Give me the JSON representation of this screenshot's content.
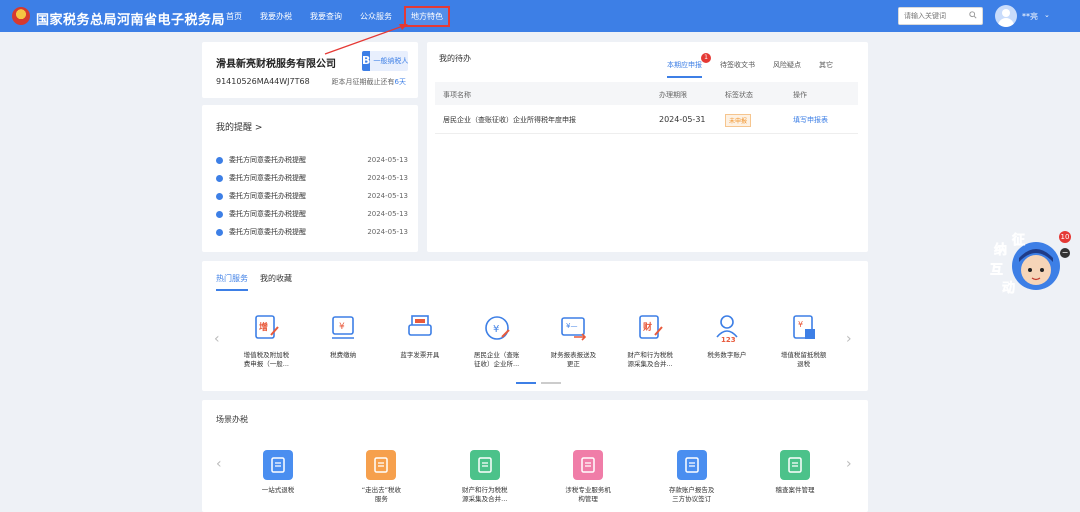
{
  "header": {
    "site_title": "国家税务总局河南省电子税务局",
    "nav": [
      "首页",
      "我要办税",
      "我要查询",
      "公众服务",
      "地方特色"
    ],
    "search_placeholder": "请输入关键词",
    "username": "**亮",
    "colors": {
      "bar": "#3d7fe6",
      "highlight_box": "#e53935"
    }
  },
  "company": {
    "name": "滑县新亮财税服务有限公司",
    "badge_letter": "B",
    "badge_text": "一般纳税人",
    "tax_id": "91410526MA44WJ7T68",
    "deadline_prefix": "距本月征期截止还有",
    "deadline_days": "6天"
  },
  "reminders": {
    "title": "我的提醒 >",
    "items": [
      {
        "text": "委托方同意委托办税提醒",
        "date": "2024-05-13"
      },
      {
        "text": "委托方同意委托办税提醒",
        "date": "2024-05-13"
      },
      {
        "text": "委托方同意委托办税提醒",
        "date": "2024-05-13"
      },
      {
        "text": "委托方同意委托办税提醒",
        "date": "2024-05-13"
      },
      {
        "text": "委托方同意委托办税提醒",
        "date": "2024-05-13"
      }
    ]
  },
  "todo": {
    "title": "我的待办",
    "tabs": [
      {
        "label": "本期应申报",
        "badge": "1"
      },
      {
        "label": "待签收文书",
        "badge": ""
      },
      {
        "label": "风险疑点",
        "badge": ""
      },
      {
        "label": "其它",
        "badge": ""
      }
    ],
    "columns": [
      "事项名称",
      "办理期限",
      "标签状态",
      "操作"
    ],
    "rows": [
      {
        "name": "居民企业（查账征收）企业所得税年度申报",
        "deadline": "2024-05-31",
        "status": "未申报",
        "action": "填写申报表"
      }
    ]
  },
  "hot": {
    "tabs": [
      "热门服务",
      "我的收藏"
    ],
    "services": [
      {
        "label1": "增值税及附加税",
        "label2": "费申报（一般...",
        "icon": "vat-declare-icon"
      },
      {
        "label1": "税费缴纳",
        "label2": "",
        "icon": "tax-payment-icon"
      },
      {
        "label1": "蓝字发票开具",
        "label2": "",
        "icon": "invoice-print-icon"
      },
      {
        "label1": "居民企业（查账",
        "label2": "征收）企业所...",
        "icon": "enterprise-tax-icon"
      },
      {
        "label1": "财务报表报送及",
        "label2": "更正",
        "icon": "financial-report-icon"
      },
      {
        "label1": "财产和行为税税",
        "label2": "源采集及合并...",
        "icon": "property-tax-icon"
      },
      {
        "label1": "税务数字账户",
        "label2": "",
        "icon": "digital-account-icon"
      },
      {
        "label1": "增值税留抵税额",
        "label2": "退税",
        "icon": "vat-refund-icon"
      }
    ]
  },
  "scene": {
    "title": "场景办税",
    "items": [
      {
        "label1": "一站式退税",
        "label2": "",
        "icon": "refund-icon",
        "color": "#4a8ef0"
      },
      {
        "label1": "“走出去”税收",
        "label2": "服务",
        "icon": "going-out-icon",
        "color": "#f6a04d"
      },
      {
        "label1": "财产和行为税税",
        "label2": "源采集及合并...",
        "icon": "property-scene-icon",
        "color": "#4cc28a"
      },
      {
        "label1": "涉税专业服务机",
        "label2": "构管理",
        "icon": "agency-icon",
        "color": "#f07da8"
      },
      {
        "label1": "存款账户报告及",
        "label2": "三方协议签订",
        "icon": "bank-account-icon",
        "color": "#4a8ef0"
      },
      {
        "label1": "稽查案件管理",
        "label2": "",
        "icon": "audit-case-icon",
        "color": "#4cc28a"
      }
    ]
  },
  "mascot": {
    "text": [
      "征",
      "纳",
      "互",
      "动"
    ],
    "badge": "10"
  }
}
